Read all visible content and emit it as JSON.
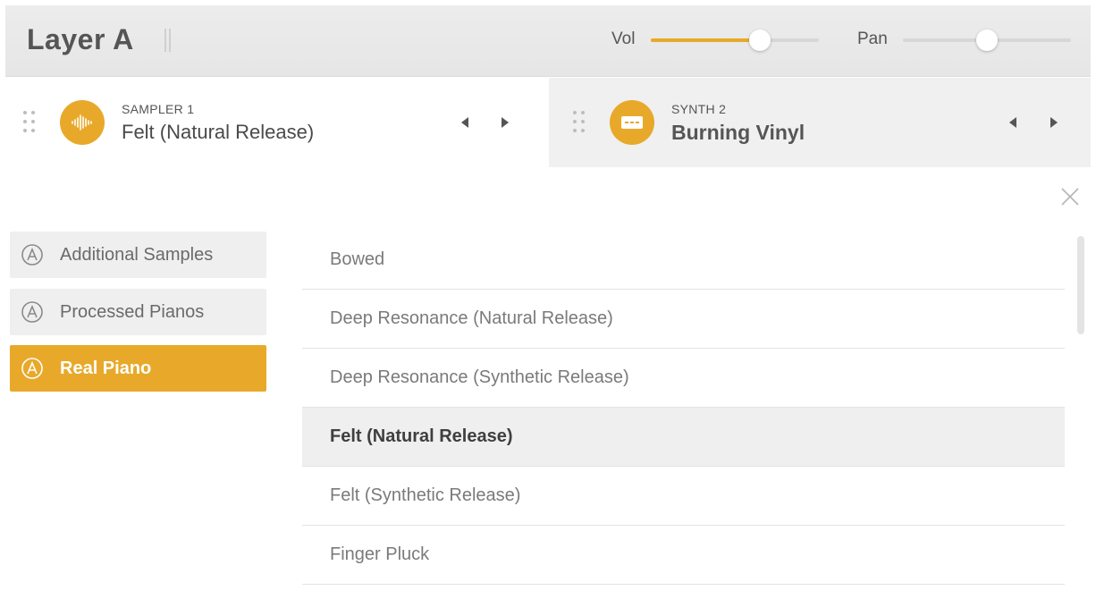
{
  "header": {
    "title": "Layer A",
    "vol_label": "Vol",
    "vol_value": 0.65,
    "pan_label": "Pan",
    "pan_value": 0.5
  },
  "slots": [
    {
      "kind": "SAMPLER 1",
      "name": "Felt (Natural Release)",
      "icon": "waveform-icon"
    },
    {
      "kind": "SYNTH 2",
      "name": "Burning Vinyl",
      "icon": "synth-icon"
    }
  ],
  "categories": [
    {
      "label": "Additional Samples",
      "active": false
    },
    {
      "label": "Processed Pianos",
      "active": false
    },
    {
      "label": "Real Piano",
      "active": true
    }
  ],
  "presets": [
    {
      "label": "Bowed",
      "selected": false
    },
    {
      "label": "Deep Resonance (Natural Release)",
      "selected": false
    },
    {
      "label": "Deep Resonance (Synthetic Release)",
      "selected": false
    },
    {
      "label": "Felt (Natural Release)",
      "selected": true
    },
    {
      "label": "Felt (Synthetic Release)",
      "selected": false
    },
    {
      "label": "Finger Pluck",
      "selected": false
    }
  ],
  "colors": {
    "accent": "#e8a92a",
    "header_bg": "#e8e8e8"
  }
}
